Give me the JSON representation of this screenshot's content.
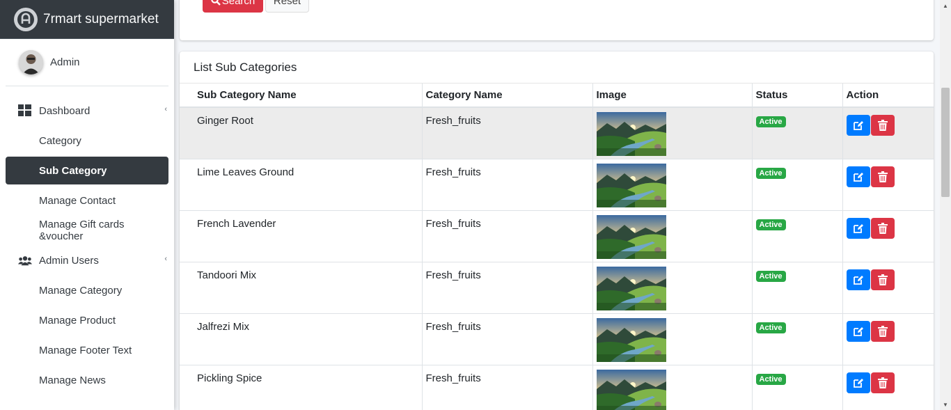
{
  "sidebar": {
    "brand": "7rmart supermarket",
    "user": "Admin",
    "items": [
      {
        "label": "Dashboard",
        "type": "parent",
        "icon": "dashboard-icon"
      },
      {
        "label": "Category",
        "type": "child"
      },
      {
        "label": "Sub Category",
        "type": "child",
        "active": true
      },
      {
        "label": "Manage Contact",
        "type": "child"
      },
      {
        "label": "Manage Gift cards &voucher",
        "type": "child"
      },
      {
        "label": "Admin Users",
        "type": "parent",
        "icon": "users-icon"
      },
      {
        "label": "Manage Category",
        "type": "child"
      },
      {
        "label": "Manage Product",
        "type": "child"
      },
      {
        "label": "Manage Footer Text",
        "type": "child"
      },
      {
        "label": "Manage News",
        "type": "child"
      }
    ]
  },
  "search": {
    "search_label": "Search",
    "reset_label": "Reset"
  },
  "list": {
    "title": "List Sub Categories",
    "columns": [
      "Sub Category Name",
      "Category Name",
      "Image",
      "Status",
      "Action"
    ],
    "rows": [
      {
        "name": "Ginger Root",
        "category": "Fresh_fruits",
        "status": "Active"
      },
      {
        "name": "Lime Leaves Ground",
        "category": "Fresh_fruits",
        "status": "Active"
      },
      {
        "name": "French Lavender",
        "category": "Fresh_fruits",
        "status": "Active"
      },
      {
        "name": "Tandoori Mix",
        "category": "Fresh_fruits",
        "status": "Active"
      },
      {
        "name": "Jalfrezi Mix",
        "category": "Fresh_fruits",
        "status": "Active"
      },
      {
        "name": "Pickling Spice",
        "category": "Fresh_fruits",
        "status": "Active"
      }
    ]
  },
  "colors": {
    "sidebar_dark": "#343a40",
    "danger": "#dc3545",
    "primary": "#007bff",
    "success": "#28a745"
  }
}
